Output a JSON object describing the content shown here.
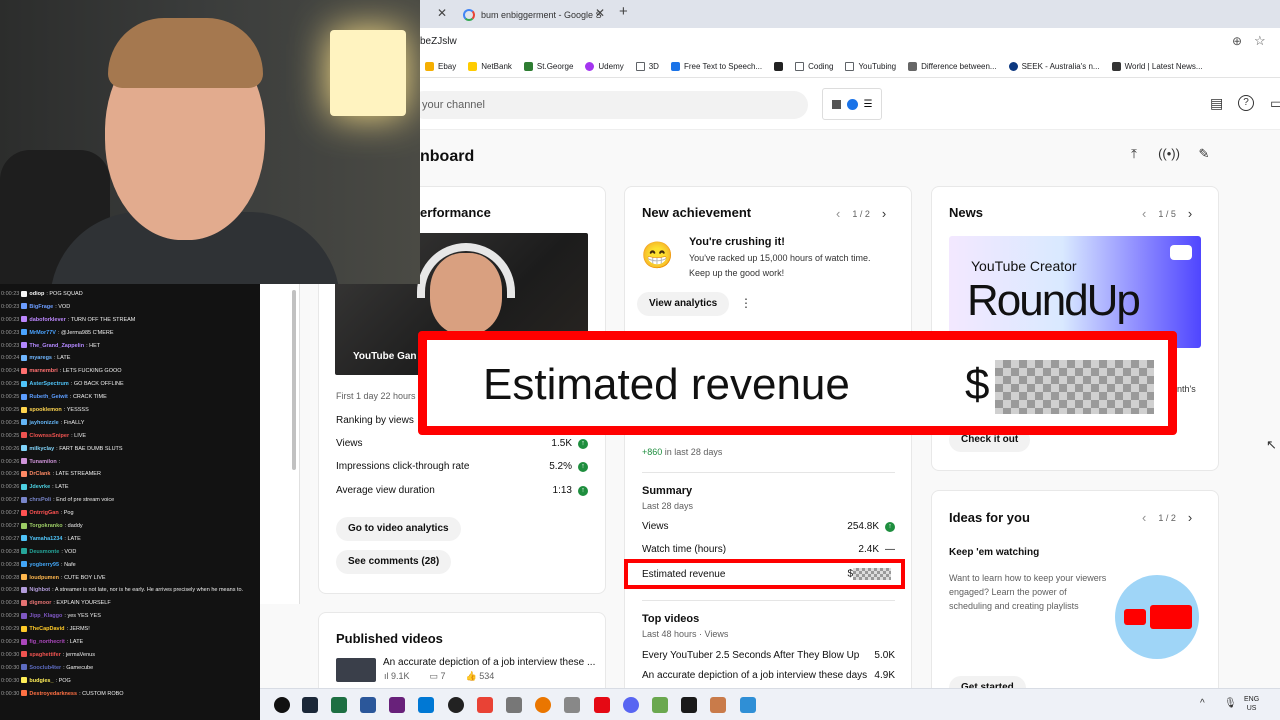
{
  "browser": {
    "tab_title": "bum enbiggerment - Google S",
    "url_fragment": "beZJslw",
    "bookmarks": [
      "Ebay",
      "NetBank",
      "St.George",
      "Udemy",
      "3D",
      "Free Text to Speech...",
      "Coding",
      "YouTubing",
      "Difference between...",
      "SEEK - Australia's n...",
      "World | Latest News..."
    ]
  },
  "studio": {
    "search_placeholder": "your channel",
    "dashboard_title": "nboard",
    "performance": {
      "title": "erformance",
      "video_caption": "YouTube Gan",
      "first_line": "First 1 day 22 hours",
      "ranking": "Ranking by views",
      "metrics": [
        {
          "label": "Views",
          "value": "1.5K"
        },
        {
          "label": "Impressions click-through rate",
          "value": "5.2%"
        },
        {
          "label": "Average view duration",
          "value": "1:13"
        }
      ],
      "btn_analytics": "Go to video analytics",
      "btn_comments": "See comments (28)"
    },
    "achievement": {
      "title": "New achievement",
      "pager": "1 / 2",
      "emoji": "😁",
      "headline": "You're crushing it!",
      "body1": "You've racked up 15,000 hours of watch time.",
      "body2": "Keep up the good work!",
      "btn": "View analytics",
      "subs_delta": "+860",
      "subs_period": "in last 28 days"
    },
    "summary": {
      "title": "Summary",
      "period": "Last 28 days",
      "rows": [
        {
          "label": "Views",
          "value": "254.8K"
        },
        {
          "label": "Watch time (hours)",
          "value": "2.4K",
          "trend": "—"
        }
      ],
      "revenue_label": "Estimated revenue",
      "revenue_prefix": "$"
    },
    "top_videos": {
      "title": "Top videos",
      "period": "Last 48 hours · Views",
      "rows": [
        {
          "label": "Every YouTuber 2.5 Seconds After They Blow Up",
          "value": "5.0K"
        },
        {
          "label": "An accurate depiction of a job interview these days",
          "value": "4.9K"
        }
      ]
    },
    "news": {
      "title": "News",
      "pager": "1 / 5",
      "img_line1": "YouTube Creator",
      "img_line2": "RoundUp",
      "partial": "nth's",
      "btn": "Check it out"
    },
    "ideas": {
      "title": "Ideas for you",
      "pager": "1 / 2",
      "headline": "Keep 'em watching",
      "body": "Want to learn how to keep your viewers engaged? Learn the power of scheduling and creating playlists",
      "btn": "Get started"
    },
    "published": {
      "title": "Published videos",
      "video_title": "An accurate depiction of a job interview these ...",
      "views": "9.1K",
      "comments": "7",
      "likes": "534"
    }
  },
  "callout": {
    "label": "Estimated revenue",
    "prefix": "$"
  },
  "chat": [
    {
      "t": "0:00:23",
      "u": "odiop",
      "m": "POG SQUAD",
      "c": "#f5f5f5"
    },
    {
      "t": "0:00:23",
      "u": "BigFrage",
      "m": "VOD",
      "c": "#6b9cff"
    },
    {
      "t": "0:00:23",
      "u": "daboforklever",
      "m": "TURN OFF THE STREAM",
      "c": "#bb86fc"
    },
    {
      "t": "0:00:23",
      "u": "MrMor77V",
      "m": "@Jerma985 C'MERE",
      "c": "#4aa3ff"
    },
    {
      "t": "0:00:23",
      "u": "The_Grand_Zappelin",
      "m": "HET",
      "c": "#b388ff"
    },
    {
      "t": "0:00:24",
      "u": "myaregs",
      "m": "LATE",
      "c": "#6fb6ff"
    },
    {
      "t": "0:00:24",
      "u": "marnembri",
      "m": "LETS FUCKING GOOO",
      "c": "#ff7070"
    },
    {
      "t": "0:00:25",
      "u": "AsterSpectrum",
      "m": "GO BACK OFFLINE",
      "c": "#4fc3f7"
    },
    {
      "t": "0:00:25",
      "u": "Rubeth_Geiwit",
      "m": "CRACK TIME",
      "c": "#5c9dff"
    },
    {
      "t": "0:00:25",
      "u": "spooklemon",
      "m": "YESSSS",
      "c": "#ffd54f"
    },
    {
      "t": "0:00:25",
      "u": "jayhonizzle",
      "m": "FinALLY",
      "c": "#64b5f6"
    },
    {
      "t": "0:00:25",
      "u": "ClownssSniper",
      "m": "LIVE",
      "c": "#ef5350"
    },
    {
      "t": "0:00:26",
      "u": "milkyclay",
      "m": "FART BAE DUMB SLUTS",
      "c": "#81d4fa"
    },
    {
      "t": "0:00:26",
      "u": "Tunamilon",
      "m": "",
      "c": "#ce93d8"
    },
    {
      "t": "0:00:26",
      "u": "DrClank",
      "m": "LATE STREAMER",
      "c": "#ff8a65"
    },
    {
      "t": "0:00:26",
      "u": "Jdevrke",
      "m": "LATE",
      "c": "#4dd0e1"
    },
    {
      "t": "0:00:27",
      "u": "chrsPoli",
      "m": "End of pre stream voice",
      "c": "#7986cb"
    },
    {
      "t": "0:00:27",
      "u": "OntrrigGan",
      "m": "Pog",
      "c": "#ff5252"
    },
    {
      "t": "0:00:27",
      "u": "Torgokranko",
      "m": "daddy",
      "c": "#9ccc65"
    },
    {
      "t": "0:00:27",
      "u": "Yamaha1234",
      "m": "LATE",
      "c": "#4fc3f7"
    },
    {
      "t": "0:00:28",
      "u": "Deusmonte",
      "m": "VOD",
      "c": "#26a69a"
    },
    {
      "t": "0:00:28",
      "u": "yogberry95",
      "m": "Nafe",
      "c": "#42a5f5"
    },
    {
      "t": "0:00:28",
      "u": "loudpumen",
      "m": "CUTE BOY LIVE",
      "c": "#ffb74d"
    },
    {
      "t": "0:00:28",
      "u": "Nighbot",
      "m": "A streamer is not late, nor is he early. He arrives precisely when he means to.",
      "c": "#b39ddb"
    },
    {
      "t": "0:00:28",
      "u": "digmoor",
      "m": "EXPLAIN YOURSELF",
      "c": "#e57373"
    },
    {
      "t": "0:00:29",
      "u": "Jipp_Klaggo",
      "m": "yes YES YES",
      "c": "#7e57c2"
    },
    {
      "t": "0:00:29",
      "u": "TheCapDavid",
      "m": "JERMS!",
      "c": "#ffca28"
    },
    {
      "t": "0:00:29",
      "u": "fig_northecrit",
      "m": "LATE",
      "c": "#ab47bc"
    },
    {
      "t": "0:00:30",
      "u": "spaghettifer",
      "m": "jermaVenus",
      "c": "#ef5350"
    },
    {
      "t": "0:00:30",
      "u": "Sooclub4ter",
      "m": "Gamecube",
      "c": "#5c6bc0"
    },
    {
      "t": "0:00:30",
      "u": "budgies_",
      "m": "POG",
      "c": "#ffee58"
    },
    {
      "t": "0:00:30",
      "u": "Destroyedarkness",
      "m": "CUSTOM ROBO",
      "c": "#ff7043"
    }
  ],
  "taskbar": {
    "lang1": "ENG",
    "lang2": "US"
  }
}
